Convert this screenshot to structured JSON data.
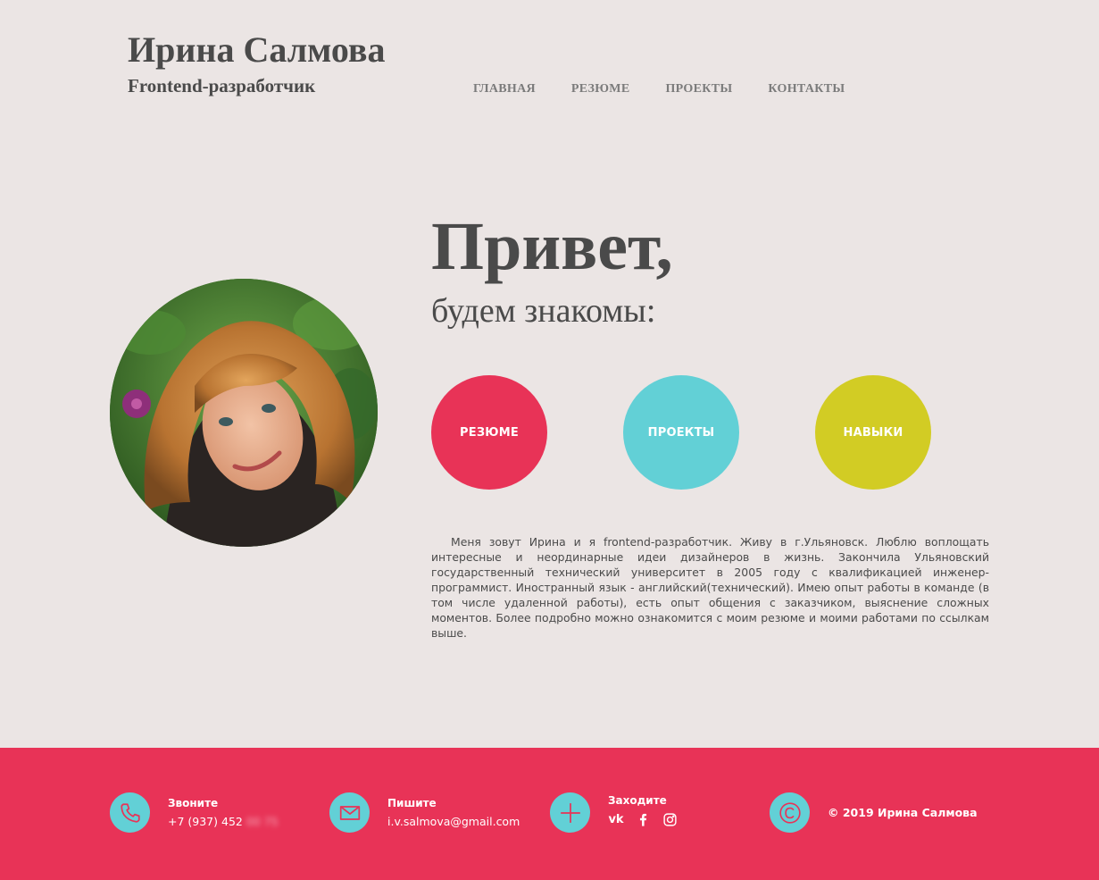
{
  "header": {
    "title": "Ирина Салмова",
    "subtitle": "Frontend-разработчик"
  },
  "nav": {
    "items": [
      {
        "label": "ГЛАВНАЯ"
      },
      {
        "label": "РЕЗЮМЕ"
      },
      {
        "label": "ПРОЕКТЫ"
      },
      {
        "label": "КОНТАКТЫ"
      }
    ]
  },
  "hero": {
    "greeting": "Привет,",
    "greeting_sub": "будем знакомы:",
    "buttons": [
      {
        "label": "РЕЗЮМЕ",
        "color": "#e83357"
      },
      {
        "label": "ПРОЕКТЫ",
        "color": "#62d0d6"
      },
      {
        "label": "НАВЫКИ",
        "color": "#d2cc24"
      }
    ],
    "about": "Меня зовут Ирина и я frontend-разработчик. Живу в г.Ульяновск. Люблю воплощать интересные и неординарные идеи дизайнеров в жизнь. Закончила Ульяновский государственный технический университет в 2005 году с квалификацией инженер-программист. Иностранный язык - английский(технический). Имею опыт работы в команде (в том числе удаленной работы), есть опыт общения с заказчиком, выяснение сложных моментов. Более подробно можно ознакомится с моим резюме и моими работами по ссылкам выше."
  },
  "footer": {
    "background": "#e83357",
    "icon_color": "#62d0d6",
    "call": {
      "label": "Звоните",
      "value": "+7 (937) 452",
      "value_hidden": "00 75",
      "icon": "phone-icon"
    },
    "write": {
      "label": "Пишите",
      "value": "i.v.salmova@gmail.com",
      "icon": "mail-icon"
    },
    "visit": {
      "label": "Заходите",
      "icon": "plus-icon",
      "socials": [
        "vk-icon",
        "facebook-icon",
        "instagram-icon"
      ],
      "vk_text": "vk"
    },
    "copyright": {
      "text": "© 2019 Ирина Салмова",
      "icon": "copyright-icon"
    }
  }
}
